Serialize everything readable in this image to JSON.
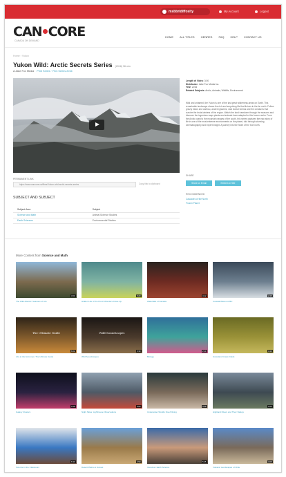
{
  "topbar": {
    "brand": "msbbridiffosity",
    "account": "My Account",
    "logout": "Logout"
  },
  "header": {
    "logo_left": "CAN",
    "logo_right": "CORE",
    "tagline": "CANADA ON DEMAND",
    "nav": [
      "HOME",
      "ALL TITLES",
      "GENRES",
      "FAQ",
      "HELP",
      "CONTACT US"
    ]
  },
  "breadcrumb": "Home › Yukon",
  "video": {
    "title": "Yukon Wild: Arctic Secrets Series",
    "year": "(2016) 36 min",
    "byline": "A Jake Fox Media",
    "byline_links": "Print Series  ·  Film Series 2016"
  },
  "permalink": {
    "label": "PERMANENT LINK",
    "value": "https://www.cancore.ca/films/Yukon-wild-arctic-secrets-series",
    "copy": "Copy link to clipboard"
  },
  "subjects": {
    "title": "SUBJECT AND SUBJECT",
    "headers": [
      "Subject Area",
      "Subject"
    ],
    "rows": [
      [
        "Science and Math",
        "Animal Science Studies"
      ],
      [
        "Earth Sciences",
        "Environmental Studies"
      ]
    ]
  },
  "meta": {
    "duration_label": "Length of Video",
    "duration": "3:00",
    "producer_label": "Distributor",
    "producer": "Jake Fox Media Inc.",
    "year_label": "Year",
    "year": "2016",
    "subjects_label": "Related Subjects",
    "subjects": "Arctic, Animals, Wildlife, Environment"
  },
  "description": "Wild and untamed, the Yukon is one of the last great wilderness areas on Earth. This remarkable landscape shows the rich and surprising life that thrives in the far north. Follow grizzly bears and caribou, ancient glaciers, vast boreal forests and the creatures that survive the brutal winters of the region. Watch the land transform through the seasons and discover the ingenious ways plants and animals have adapted to this frozen realm. From the Arctic coast to the mountain ranges of the south, this series captures the epic story of life in one of the most extreme environments on the planet, told through stunning cinematography and expert insight. A journey into the heart of the true north.",
  "share": {
    "label": "SHARE",
    "buttons": [
      "Share on Email",
      "Embed on Site"
    ]
  },
  "recommended": {
    "label": "RECOMMENDED",
    "links": [
      "Cascades of the North",
      "Frozen Planet"
    ]
  },
  "related": {
    "prefix": "More Content from",
    "category": "Science and Math",
    "items": [
      {
        "caption": "The Wild Atlantic: Seasons of Life",
        "duration": "3:00",
        "colors": [
          "#8fb6d8",
          "#7c6a4e",
          "#3d4a2f"
        ]
      },
      {
        "caption": "Hidden Life of the Pond: Wonders Close Up",
        "duration": "5:20",
        "colors": [
          "#4f8a8c",
          "#7fb3a3",
          "#c9d35a"
        ]
      },
      {
        "caption": "Waterfalls of Canada",
        "duration": "4:12",
        "colors": [
          "#2b2320",
          "#6e2b22",
          "#9c4531"
        ]
      },
      {
        "caption": "Coastal Waves of BC",
        "duration": "2:45",
        "colors": [
          "#3b4a5a",
          "#6d7f8f",
          "#d7dde2"
        ]
      },
      {
        "caption": "Life at the Extremes: The Ultimate Guide",
        "duration": "6:02",
        "colors": [
          "#2e2418",
          "#805a2c",
          "#c98a3a"
        ],
        "overlay": "The Ultimate Guide"
      },
      {
        "caption": "Wild Soundscapes",
        "duration": "3:30",
        "colors": [
          "#1a1614",
          "#4a3a2c",
          "#8a6e4a"
        ],
        "overlay": "Wild Soundscapes"
      },
      {
        "caption": "Biology",
        "duration": "2:10",
        "colors": [
          "#2f6f9a",
          "#3fa39b",
          "#d25a8c"
        ]
      },
      {
        "caption": "Grassland Grass Fields",
        "duration": "4:40",
        "colors": [
          "#6a6a24",
          "#9a9238",
          "#c5b85c"
        ]
      },
      {
        "caption": "Galaxy Clusters",
        "duration": "3:15",
        "colors": [
          "#0d0f1c",
          "#2a2240",
          "#c23d6b"
        ]
      },
      {
        "caption": "Night Skies: Lighthouse Observations",
        "duration": "5:00",
        "colors": [
          "#8fa0b0",
          "#4e5a66",
          "#c54a3a"
        ]
      },
      {
        "caption": "Underwater Worlds: Reef Diving",
        "duration": "4:25",
        "colors": [
          "#2a3a3c",
          "#7a6a5a",
          "#c9b8a6"
        ]
      },
      {
        "caption": "Highland Rivers and Their Valleys",
        "duration": "3:55",
        "colors": [
          "#7a8a9a",
          "#3e4a52",
          "#6a7a60"
        ]
      },
      {
        "caption": "Science in the Classroom",
        "duration": "6:30",
        "colors": [
          "#dfe4ea",
          "#3a78c2",
          "#6b4a3a"
        ]
      },
      {
        "caption": "Desert Plains at Sunset",
        "duration": "2:50",
        "colors": [
          "#6aa0d8",
          "#9a7a4a",
          "#c9a874"
        ]
      },
      {
        "caption": "Interview: Earth Science",
        "duration": "5:45",
        "colors": [
          "#3a6aa8",
          "#c99a7a",
          "#4a4038"
        ]
      },
      {
        "caption": "Volcanic Landscapes of Chile",
        "duration": "4:05",
        "colors": [
          "#5a8ac8",
          "#7a6a5a",
          "#c9b89a"
        ]
      }
    ]
  }
}
